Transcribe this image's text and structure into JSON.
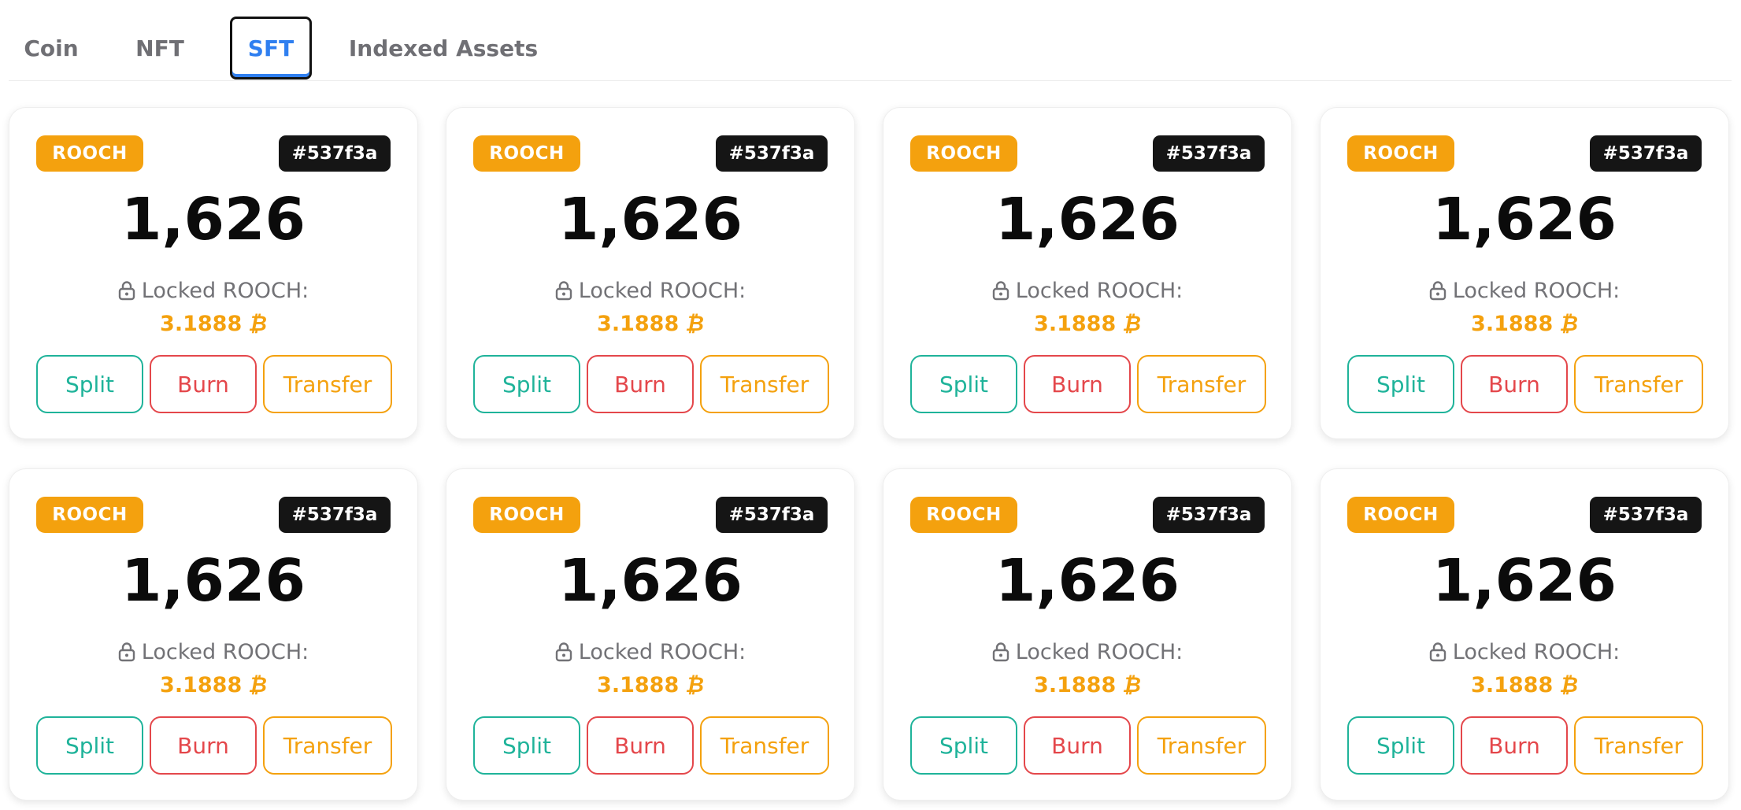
{
  "tabs": [
    {
      "label": "Coin",
      "active": false
    },
    {
      "label": "NFT",
      "active": false
    },
    {
      "label": "SFT",
      "active": true
    },
    {
      "label": "Indexed Assets",
      "active": false
    }
  ],
  "cards": [
    {
      "token": "ROOCH",
      "id": "#537f3a",
      "amount": "1,626",
      "locked_label": "Locked ROOCH:",
      "locked_value": "3.1888",
      "currency_symbol": "₿",
      "split_label": "Split",
      "burn_label": "Burn",
      "transfer_label": "Transfer"
    },
    {
      "token": "ROOCH",
      "id": "#537f3a",
      "amount": "1,626",
      "locked_label": "Locked ROOCH:",
      "locked_value": "3.1888",
      "currency_symbol": "₿",
      "split_label": "Split",
      "burn_label": "Burn",
      "transfer_label": "Transfer"
    },
    {
      "token": "ROOCH",
      "id": "#537f3a",
      "amount": "1,626",
      "locked_label": "Locked ROOCH:",
      "locked_value": "3.1888",
      "currency_symbol": "₿",
      "split_label": "Split",
      "burn_label": "Burn",
      "transfer_label": "Transfer"
    },
    {
      "token": "ROOCH",
      "id": "#537f3a",
      "amount": "1,626",
      "locked_label": "Locked ROOCH:",
      "locked_value": "3.1888",
      "currency_symbol": "₿",
      "split_label": "Split",
      "burn_label": "Burn",
      "transfer_label": "Transfer"
    },
    {
      "token": "ROOCH",
      "id": "#537f3a",
      "amount": "1,626",
      "locked_label": "Locked ROOCH:",
      "locked_value": "3.1888",
      "currency_symbol": "₿",
      "split_label": "Split",
      "burn_label": "Burn",
      "transfer_label": "Transfer"
    },
    {
      "token": "ROOCH",
      "id": "#537f3a",
      "amount": "1,626",
      "locked_label": "Locked ROOCH:",
      "locked_value": "3.1888",
      "currency_symbol": "₿",
      "split_label": "Split",
      "burn_label": "Burn",
      "transfer_label": "Transfer"
    },
    {
      "token": "ROOCH",
      "id": "#537f3a",
      "amount": "1,626",
      "locked_label": "Locked ROOCH:",
      "locked_value": "3.1888",
      "currency_symbol": "₿",
      "split_label": "Split",
      "burn_label": "Burn",
      "transfer_label": "Transfer"
    },
    {
      "token": "ROOCH",
      "id": "#537f3a",
      "amount": "1,626",
      "locked_label": "Locked ROOCH:",
      "locked_value": "3.1888",
      "currency_symbol": "₿",
      "split_label": "Split",
      "burn_label": "Burn",
      "transfer_label": "Transfer"
    }
  ],
  "colors": {
    "active_tab": "#2f7ff0",
    "token_badge": "#f4a10e",
    "id_badge": "#151515",
    "split": "#1fb39a",
    "burn": "#e4474b",
    "transfer": "#f4a10e"
  }
}
